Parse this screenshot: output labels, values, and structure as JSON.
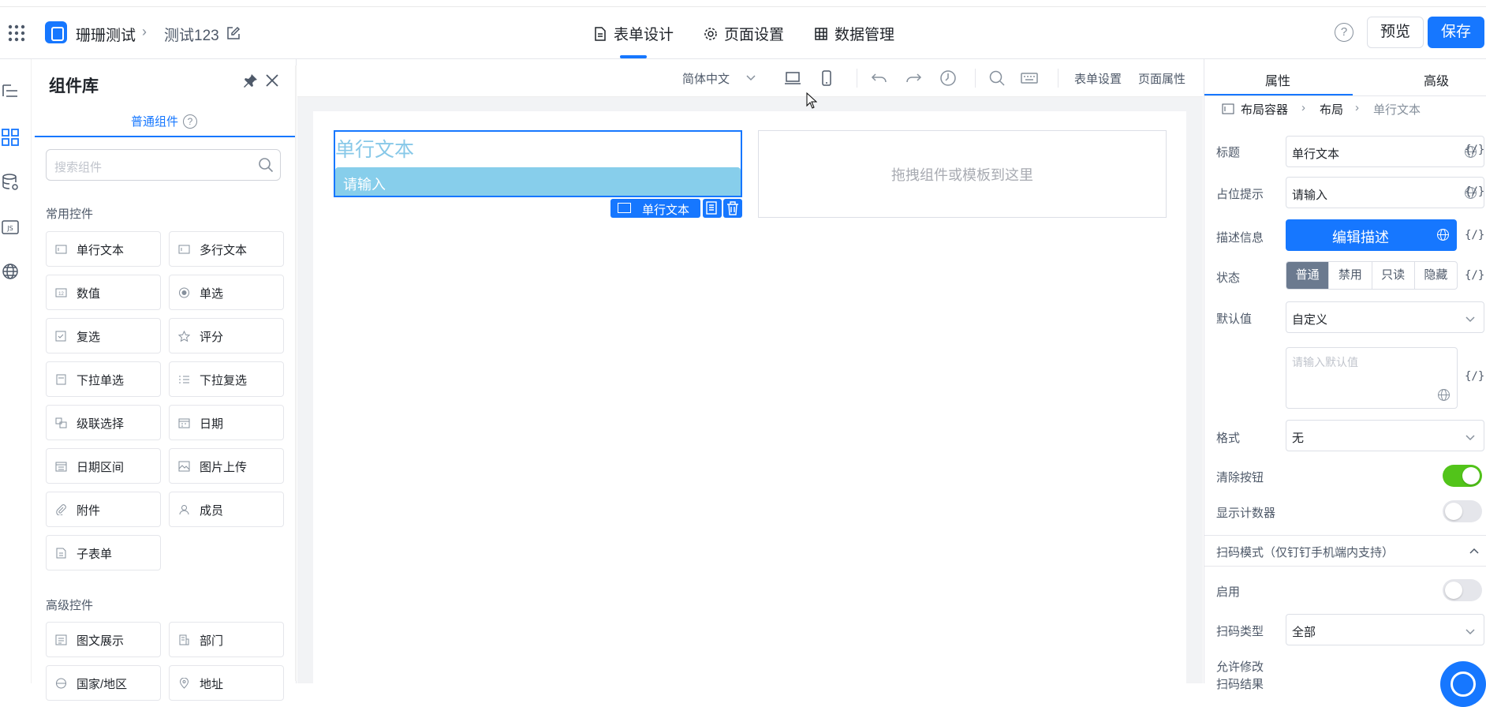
{
  "header": {
    "app_name": "珊珊测试",
    "page_name": "测试123",
    "tabs": [
      {
        "label": "表单设计",
        "icon": "document-icon",
        "active": true
      },
      {
        "label": "页面设置",
        "icon": "gear-icon",
        "active": false
      },
      {
        "label": "数据管理",
        "icon": "table-icon",
        "active": false
      }
    ],
    "preview_label": "预览",
    "save_label": "保存",
    "accent": "#1677ff"
  },
  "rail": {
    "icons": [
      "outline-icon",
      "components-icon",
      "datasource-icon",
      "js-icon",
      "globe-icon"
    ]
  },
  "library": {
    "title": "组件库",
    "tab": "普通组件",
    "search_placeholder": "搜索组件",
    "groups": [
      {
        "title": "常用控件",
        "items": [
          "单行文本",
          "多行文本",
          "数值",
          "单选",
          "复选",
          "评分",
          "下拉单选",
          "下拉复选",
          "级联选择",
          "日期",
          "日期区间",
          "图片上传",
          "附件",
          "成员",
          "子表单"
        ]
      },
      {
        "title": "高级控件",
        "items": [
          "图文展示",
          "部门",
          "国家/地区",
          "地址"
        ]
      }
    ]
  },
  "toolbar": {
    "language": "简体中文",
    "form_settings": "表单设置",
    "page_properties": "页面属性"
  },
  "canvas": {
    "field_title": "单行文本",
    "field_placeholder": "请输入",
    "selected_tag": "单行文本",
    "drop_hint": "拖拽组件或模板到这里"
  },
  "props": {
    "tabs": [
      "属性",
      "高级"
    ],
    "breadcrumb": [
      "布局容器",
      "布局",
      "单行文本"
    ],
    "title_label": "标题",
    "title_value": "单行文本",
    "placeholder_label": "占位提示",
    "placeholder_value": "请输入",
    "desc_label": "描述信息",
    "desc_button": "编辑描述",
    "state_label": "状态",
    "state_options": [
      "普通",
      "禁用",
      "只读",
      "隐藏"
    ],
    "state_selected": "普通",
    "default_label": "默认值",
    "default_mode": "自定义",
    "default_placeholder": "请输入默认值",
    "format_label": "格式",
    "format_value": "无",
    "clear_label": "清除按钮",
    "clear_on": true,
    "counter_label": "显示计数器",
    "counter_on": false,
    "scan_section": "扫码模式（仅钉钉手机端内支持）",
    "scan_enable_label": "启用",
    "scan_enable_on": false,
    "scan_type_label": "扫码类型",
    "scan_type_value": "全部",
    "allow_edit_line1": "允许修改",
    "allow_edit_line2": "扫码结果",
    "fx": "{/}"
  }
}
